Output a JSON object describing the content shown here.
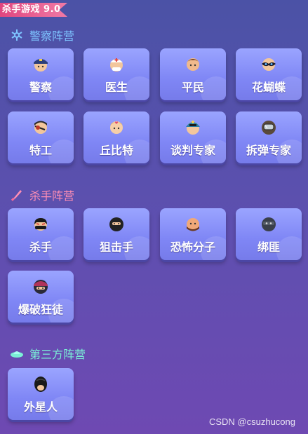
{
  "header": {
    "ribbon_text": "杀手游戏 9.0"
  },
  "sections": [
    {
      "title": "警察阵营",
      "title_color": "#7ec4ff",
      "icon": "snowflake-icon",
      "roles": [
        "警察",
        "医生",
        "平民",
        "花蝴蝶",
        "特工",
        "丘比特",
        "谈判专家",
        "拆弹专家"
      ]
    },
    {
      "title": "杀手阵营",
      "title_color": "#ff8eb4",
      "icon": "knife-icon",
      "roles": [
        "杀手",
        "狙击手",
        "恐怖分子",
        "绑匪",
        "爆破狂徒"
      ]
    },
    {
      "title": "第三方阵营",
      "title_color": "#7af0d6",
      "icon": "ufo-icon",
      "roles": [
        "外星人"
      ]
    }
  ],
  "watermark": "CSDN @csuzhucong",
  "avatar_icons": [
    "police-avatar-icon",
    "doctor-avatar-icon",
    "civilian-avatar-icon",
    "butterfly-avatar-icon",
    "agent-avatar-icon",
    "cupid-avatar-icon",
    "negotiator-avatar-icon",
    "bomb-expert-avatar-icon",
    "killer-avatar-icon",
    "sniper-avatar-icon",
    "terrorist-avatar-icon",
    "kidnapper-avatar-icon",
    "bomber-avatar-icon",
    "alien-avatar-icon"
  ]
}
